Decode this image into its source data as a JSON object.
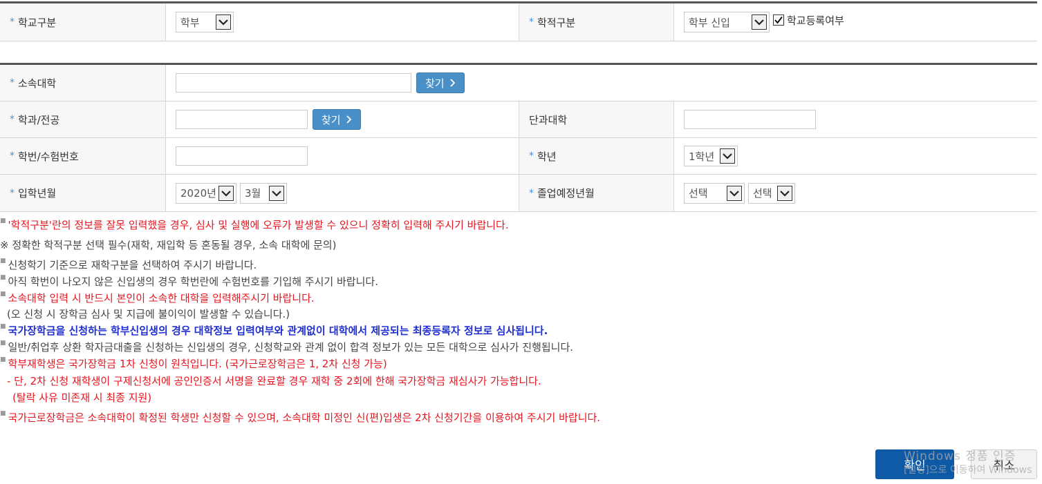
{
  "section1": {
    "school_type_label": "학교구분",
    "school_type_value": "학부",
    "enroll_type_label": "학적구분",
    "enroll_type_value": "학부 신입",
    "registered_label": "학교등록여부"
  },
  "section2": {
    "university_label": "소속대학",
    "find_label": "찾기",
    "dept_label": "학과/전공",
    "college_label": "단과대학",
    "student_id_label": "학번/수험번호",
    "grade_label": "학년",
    "grade_value": "1학년",
    "admission_label": "입학년월",
    "admission_year": "2020년",
    "admission_month": "3월",
    "graduation_label": "졸업예정년월",
    "graduation_year": "선택",
    "graduation_month": "선택"
  },
  "notes": [
    "'학적구분'란의 정보를 잘못 입력했을 경우, 심사 및 실행에 오류가 발생할 수 있으니 정확히 입력해 주시기 바랍니다.",
    "※ 정확한 학적구분 선택 필수(재학, 재입학 등 혼동될 경우, 소속 대학에 문의)",
    "신청학기 기준으로 재학구분을 선택하여 주시기 바랍니다.",
    "아직 학번이 나오지 않은 신입생의 경우 학번란에 수험번호를 기입해 주시기 바랍니다.",
    "소속대학 입력 시 반드시 본인이 소속한 대학을 입력해주시기 바랍니다.",
    "(오 신청 시 장학금 심사 및 지급에 불이익이 발생할 수 있습니다.)",
    "국가장학금을 신청하는 학부신입생의 경우 대학정보 입력여부와 관계없이 대학에서 제공되는 최종등록자 정보로 심사됩니다.",
    "일반/취업후 상환 학자금대출을 신청하는 신입생의 경우, 신청학교와 관계 없이 합격 정보가 있는 모든 대학으로 심사가 진행됩니다.",
    "학부재학생은 국가장학금 1차 신청이 원칙입니다. (국가근로장학금은 1, 2차 신청 가능)",
    "- 단, 2차 신청 재학생이 구제신청서에 공인인증서 서명을 완료할 경우 재학 중 2회에 한해 국가장학금 재심사가 가능합니다.",
    "(탈락 사유 미존재 시 최종 지원)",
    "국가근로장학금은 소속대학이 확정된 학생만 신청할 수 있으며, 소속대학 미정인 신(편)입생은 2차 신청기간을 이용하여 주시기 바랍니다."
  ],
  "buttons": {
    "confirm": "확인",
    "cancel": "취소"
  },
  "watermark": {
    "line1": "Windows 정품 인증",
    "line2": "[설정]으로 이동하여 Windows"
  },
  "colors": {
    "accent": "#4a90c8",
    "primary_button": "#0f5aa6",
    "warning_red": "#e4161f",
    "emphasis_blue": "#1f2fcf"
  }
}
